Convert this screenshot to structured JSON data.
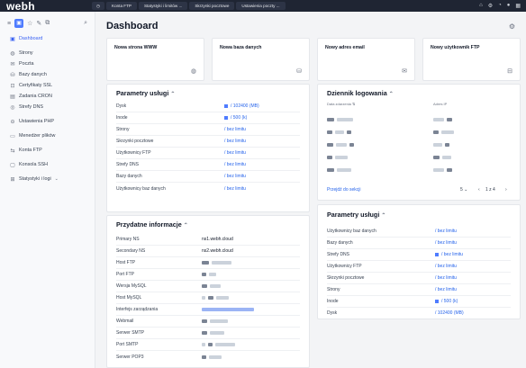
{
  "topbar": {
    "logo": "webh",
    "tabs": [
      "Konta FTP",
      "Statystyki i limitów ...",
      "Skrzynki pocztowe",
      "Ustawienia poczty ..."
    ],
    "icons": [
      "home-icon",
      "settings-icon",
      "bell-icon",
      "user-icon",
      "grid-icon"
    ]
  },
  "sidebar": {
    "items": [
      {
        "label": "Dashboard",
        "icon": "dashboard-icon",
        "active": true
      },
      {
        "label": "Strony",
        "icon": "globe-icon"
      },
      {
        "label": "Poczta",
        "icon": "mail-icon"
      },
      {
        "label": "Bazy danych",
        "icon": "database-icon"
      },
      {
        "label": "Certyfikaty SSL",
        "icon": "certificate-icon"
      },
      {
        "label": "Zadania CRON",
        "icon": "calendar-icon"
      },
      {
        "label": "Strefy DNS",
        "icon": "dns-icon"
      },
      {
        "label": "Ustawienia PHP",
        "icon": "php-icon"
      },
      {
        "label": "Menedżer plików",
        "icon": "file-manager-icon"
      },
      {
        "label": "Konta FTP",
        "icon": "ftp-icon"
      },
      {
        "label": "Konsola SSH",
        "icon": "terminal-icon"
      },
      {
        "label": "Statystyki i logi",
        "icon": "stats-icon"
      }
    ]
  },
  "page": {
    "title": "Dashboard"
  },
  "quick": [
    {
      "label": "Nowa strona WWW",
      "icon": "globe-icon"
    },
    {
      "label": "Nowa baza danych",
      "icon": "database-icon"
    },
    {
      "label": "Nowy adres email",
      "icon": "mail-icon"
    },
    {
      "label": "Nowy użytkownik FTP",
      "icon": "user-ftp-icon"
    }
  ],
  "params_left": {
    "title": "Parametry usługi",
    "rows": [
      {
        "k": "Dysk",
        "v": "/ 102400 (MB)"
      },
      {
        "k": "Inode",
        "v": "/ 500 (k)"
      },
      {
        "k": "Strony",
        "v": "/ bez limitu"
      },
      {
        "k": "Skrzynki pocztowe",
        "v": "/ bez limitu"
      },
      {
        "k": "Użytkownicy FTP",
        "v": "/ bez limitu"
      },
      {
        "k": "Strefy DNS",
        "v": "/ bez limitu"
      },
      {
        "k": "Bazy danych",
        "v": "/ bez limitu"
      },
      {
        "k": "Użytkownicy baz danych",
        "v": "/ bez limitu"
      }
    ]
  },
  "info": {
    "title": "Przydatne informacje",
    "rows": [
      {
        "k": "Primary NS",
        "v": "ns1.webh.cloud"
      },
      {
        "k": "Secondary NS",
        "v": "ns2.webh.cloud"
      },
      {
        "k": "Host FTP",
        "v": ""
      },
      {
        "k": "Port FTP",
        "v": ""
      },
      {
        "k": "Wersja MySQL",
        "v": ""
      },
      {
        "k": "Host MySQL",
        "v": ""
      },
      {
        "k": "Interfejs zarządzania",
        "v": ""
      },
      {
        "k": "Webmail",
        "v": ""
      },
      {
        "k": "Serwer SMTP",
        "v": ""
      },
      {
        "k": "Port SMTP",
        "v": ""
      },
      {
        "k": "Serwer POP3",
        "v": ""
      }
    ]
  },
  "log": {
    "title": "Dziennik logowania",
    "col1": "Data zdarzenia",
    "col2": "Adres IP",
    "link": "Przejdź do sekcji",
    "pager": "5",
    "pages": "1 z 4"
  },
  "params_right": {
    "title": "Parametry usługi",
    "rows": [
      {
        "k": "Użytkownicy baz danych",
        "v": "/ bez limitu"
      },
      {
        "k": "Bazy danych",
        "v": "/ bez limitu"
      },
      {
        "k": "Strefy DNS",
        "v": "/ bez limitu"
      },
      {
        "k": "Użytkownicy FTP",
        "v": "/ bez limitu"
      },
      {
        "k": "Skrzynki pocztowe",
        "v": "/ bez limitu"
      },
      {
        "k": "Strony",
        "v": "/ bez limitu"
      },
      {
        "k": "Inode",
        "v": "/ 500 (k)"
      },
      {
        "k": "Dysk",
        "v": "/ 102400 (MB)"
      }
    ]
  }
}
